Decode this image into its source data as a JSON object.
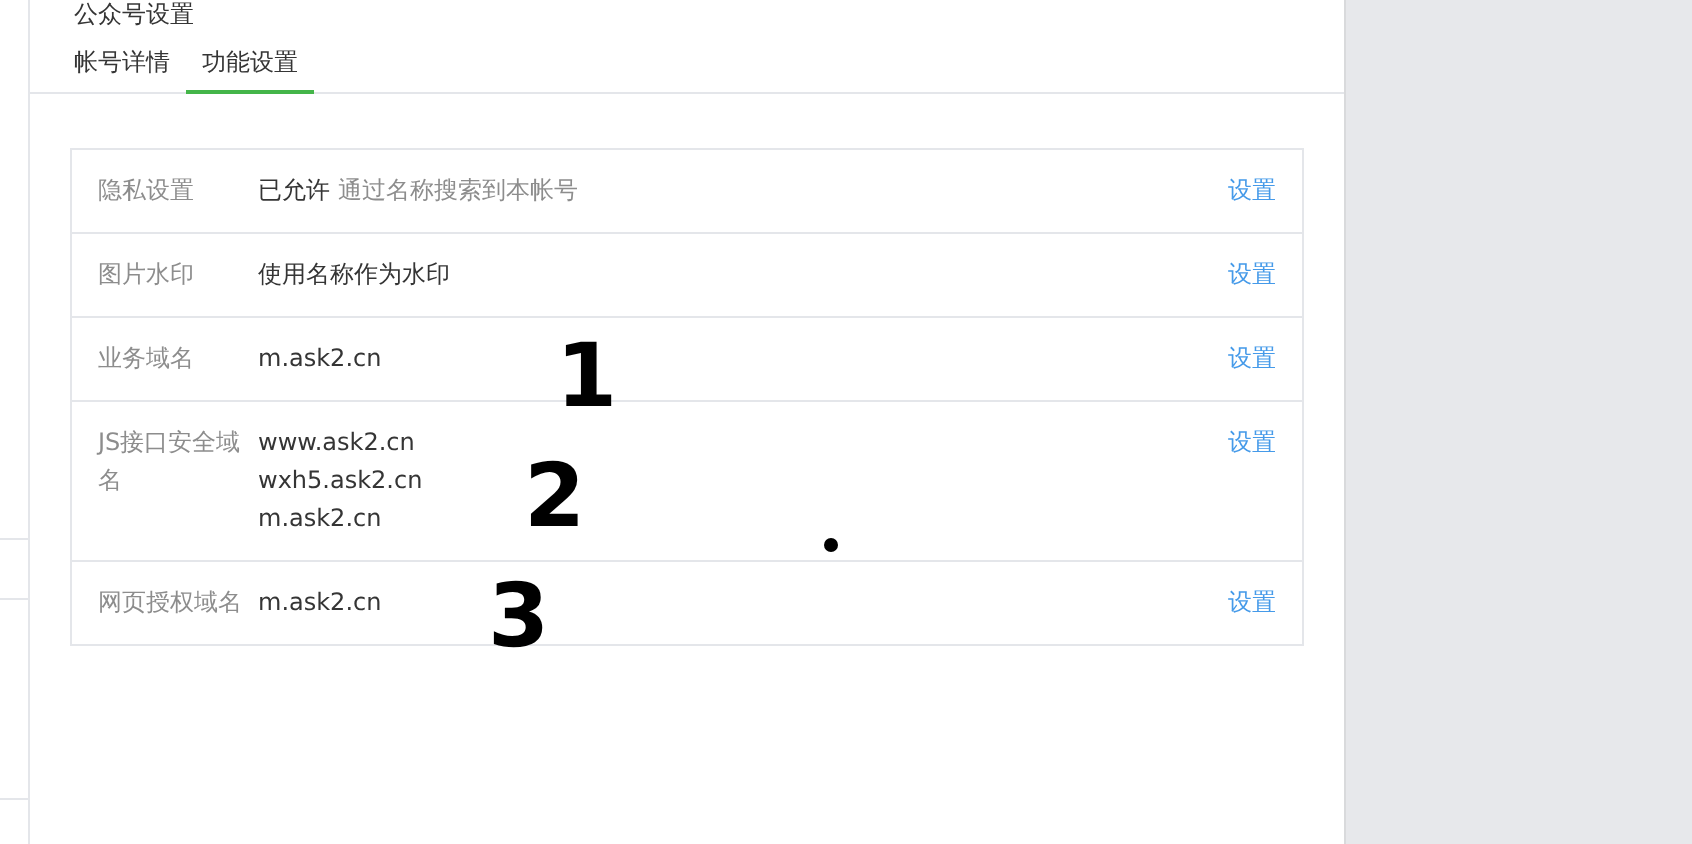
{
  "page_title": "公众号设置",
  "tabs": [
    {
      "label": "帐号详情",
      "selected": false
    },
    {
      "label": "功能设置",
      "selected": true
    }
  ],
  "settings": [
    {
      "label": "隐私设置",
      "values": [
        "已允许"
      ],
      "note": "通过名称搜索到本帐号",
      "action": "设置"
    },
    {
      "label": "图片水印",
      "values": [
        "使用名称作为水印"
      ],
      "action": "设置"
    },
    {
      "label": "业务域名",
      "values": [
        "m.ask2.cn"
      ],
      "action": "设置"
    },
    {
      "label": "JS接口安全域名",
      "values": [
        "www.ask2.cn",
        "wxh5.ask2.cn",
        "m.ask2.cn"
      ],
      "action": "设置"
    },
    {
      "label": "网页授权域名",
      "values": [
        "m.ask2.cn"
      ],
      "action": "设置"
    }
  ],
  "annotations": [
    {
      "text": "1"
    },
    {
      "text": "2"
    },
    {
      "text": "3"
    }
  ]
}
